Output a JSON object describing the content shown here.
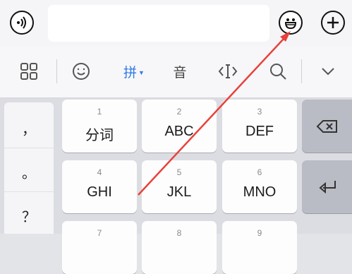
{
  "input_bar": {
    "voice_icon": "voice-icon",
    "text_value": "",
    "emoji_icon": "emoji-icon",
    "plus_icon": "plus-icon"
  },
  "toolbar": {
    "items": [
      {
        "icon": "grid-icon"
      },
      {
        "icon": "smiley-icon"
      },
      {
        "label": "拼",
        "icon": "triangle-down-icon",
        "active": true
      },
      {
        "label": "音"
      },
      {
        "icon": "cursor-icon"
      },
      {
        "icon": "search-icon"
      },
      {
        "icon": "chevron-down-icon"
      }
    ],
    "accent_color": "#2f7ae5"
  },
  "punctuation": [
    "，",
    "。",
    "？"
  ],
  "keys": [
    {
      "num": "1",
      "label": "分词"
    },
    {
      "num": "2",
      "label": "ABC"
    },
    {
      "num": "3",
      "label": "DEF"
    },
    {
      "num": "4",
      "label": "GHI"
    },
    {
      "num": "5",
      "label": "JKL"
    },
    {
      "num": "6",
      "label": "MNO"
    },
    {
      "num": "7",
      "label": ""
    },
    {
      "num": "8",
      "label": ""
    },
    {
      "num": "9",
      "label": ""
    }
  ],
  "function_keys": [
    "backspace-icon",
    "enter-icon"
  ],
  "annotation": {
    "type": "arrow",
    "color": "#e8413a"
  }
}
